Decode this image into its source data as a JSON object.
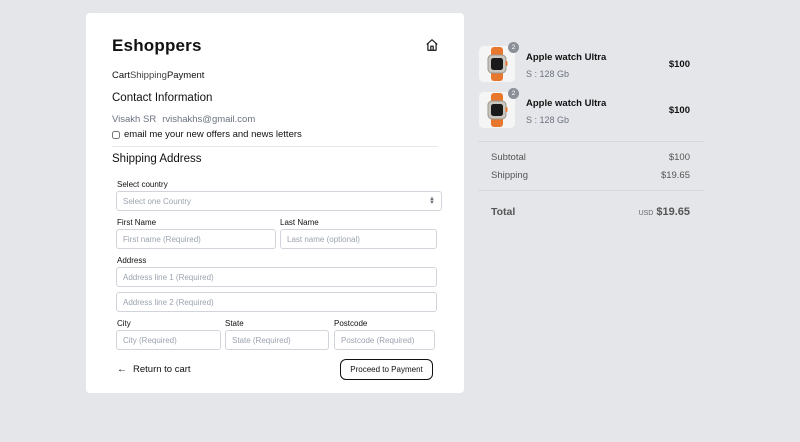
{
  "header": {
    "brand": "Eshoppers"
  },
  "breadcrumb": {
    "cart": "Cart",
    "shipping": "Shipping",
    "payment": "Payment"
  },
  "contact": {
    "title": "Contact Information",
    "name": "Visakh SR",
    "email": "rvishakhs@gmail.com",
    "newsletter_label": "email me your new offers and news letters",
    "newsletter_checked": false
  },
  "shipping": {
    "title": "Shipping Address",
    "country_label": "Select country",
    "country_placeholder": "Select one Country",
    "first_name_label": "First Name",
    "first_name_placeholder": "First name (Required)",
    "last_name_label": "Last Name",
    "last_name_placeholder": "Last name (optional)",
    "address_label": "Address",
    "address1_placeholder": "Address line 1 (Required)",
    "address2_placeholder": "Address line 2 (Required)",
    "city_label": "City",
    "city_placeholder": "City (Required)",
    "state_label": "State",
    "state_placeholder": "State (Required)",
    "postcode_label": "Postcode",
    "postcode_placeholder": "Postcode (Required)"
  },
  "actions": {
    "return_label": "Return to cart",
    "proceed_label": "Proceed to Payment"
  },
  "order": {
    "items": [
      {
        "name": "Apple watch Ultra",
        "variant": "S : 128 Gb",
        "price": "$100",
        "qty": "2"
      },
      {
        "name": "Apple watch Ultra",
        "variant": "S : 128 Gb",
        "price": "$100",
        "qty": "2"
      }
    ],
    "subtotal_label": "Subtotal",
    "subtotal_value": "$100",
    "shipping_label": "Shipping",
    "shipping_value": "$19.65",
    "total_label": "Total",
    "total_currency": "USD",
    "total_value": "$19.65"
  },
  "colors": {
    "page_bg": "#e5e6e9",
    "band_orange": "#e8772e",
    "badge": "#8a8f98"
  }
}
